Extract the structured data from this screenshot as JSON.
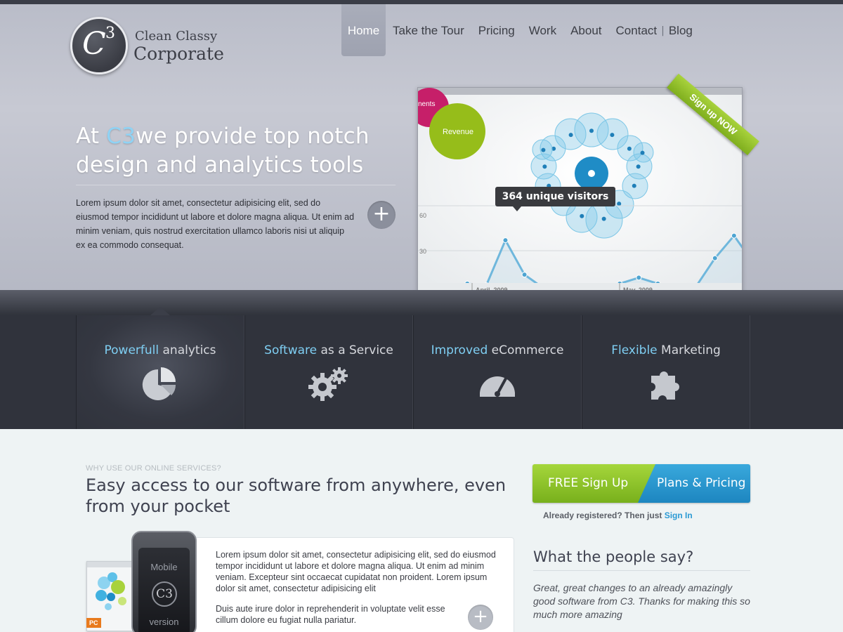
{
  "logo": {
    "mark": "C",
    "mark_sup": "3",
    "line1": "Clean Classy",
    "line2": "Corporate"
  },
  "nav": {
    "items": [
      "Home",
      "Take the Tour",
      "Pricing",
      "Work",
      "About",
      "Contact",
      "Blog"
    ],
    "active": "Home"
  },
  "hero": {
    "headline_prefix": "At ",
    "headline_accent": "C3",
    "headline_rest": "we provide top notch design and analytics tools",
    "body": "Lorem ipsum dolor sit amet, consectetur adipisicing elit, sed do eiusmod tempor incididunt ut labore et dolore magna aliqua. Ut enim ad minim veniam, quis nostrud exercitation ullamco laboris nisi ut aliquip ex ea commodo consequat.",
    "more_label": "+"
  },
  "showcase": {
    "ribbon": "Sign up NOW",
    "tooltip": "364 unique visitors",
    "bubble_label_1": "Revenue",
    "bubble_label_2": "nents",
    "y_ticks": [
      "60",
      "30"
    ],
    "x_labels": [
      "April, 2009",
      "May, 2009"
    ]
  },
  "chart_data": {
    "type": "line",
    "y_ticks": [
      30,
      60
    ],
    "values": [
      6,
      6,
      8,
      7,
      37,
      14,
      5,
      2,
      3,
      4,
      8,
      12,
      8,
      5,
      6,
      25,
      40,
      22
    ]
  },
  "features": [
    {
      "highlight": "Powerfull",
      "rest": " analytics",
      "icon": "pie-chart-icon"
    },
    {
      "highlight": "Software",
      "rest": " as a Service",
      "icon": "gears-icon"
    },
    {
      "highlight": "Improved",
      "rest": " eCommerce",
      "icon": "speedometer-icon"
    },
    {
      "highlight": "Flexible",
      "rest": " Marketing",
      "icon": "puzzle-icon"
    }
  ],
  "why": {
    "kicker": "WHY USE OUR ONLINE SERVICES?",
    "title": "Easy access to our software from anywhere, even from your pocket",
    "para1": "Lorem ipsum dolor sit amet, consectetur adipisicing elit, sed do eiusmod tempor incididunt ut labore et dolore magna aliqua. Ut enim ad minim veniam. Excepteur sint occaecat cupidatat non proident. Lorem ipsum dolor sit amet, consectetur adipisicing elit",
    "para2": "Duis aute irure dolor in reprehenderit in voluptate velit esse cillum dolore eu fugiat nulla pariatur.",
    "more_label": "+",
    "phone_top": "Mobile",
    "phone_logo": "C3",
    "phone_bottom": "version",
    "pc_badge": "PC"
  },
  "cta": {
    "free": "FREE Sign Up",
    "plans": "Plans & Pricing",
    "already": "Already registered? Then just ",
    "signin": "Sign In"
  },
  "testimonials": {
    "title": "What the people say?",
    "quote": "Great, great changes to an already amazingly good software from C3. Thanks for making this so much more amazing"
  },
  "colors": {
    "accent_blue": "#7fcff3",
    "cta_green": "#8cc22a",
    "cta_blue": "#2b9ad4",
    "band": "#30333c"
  }
}
